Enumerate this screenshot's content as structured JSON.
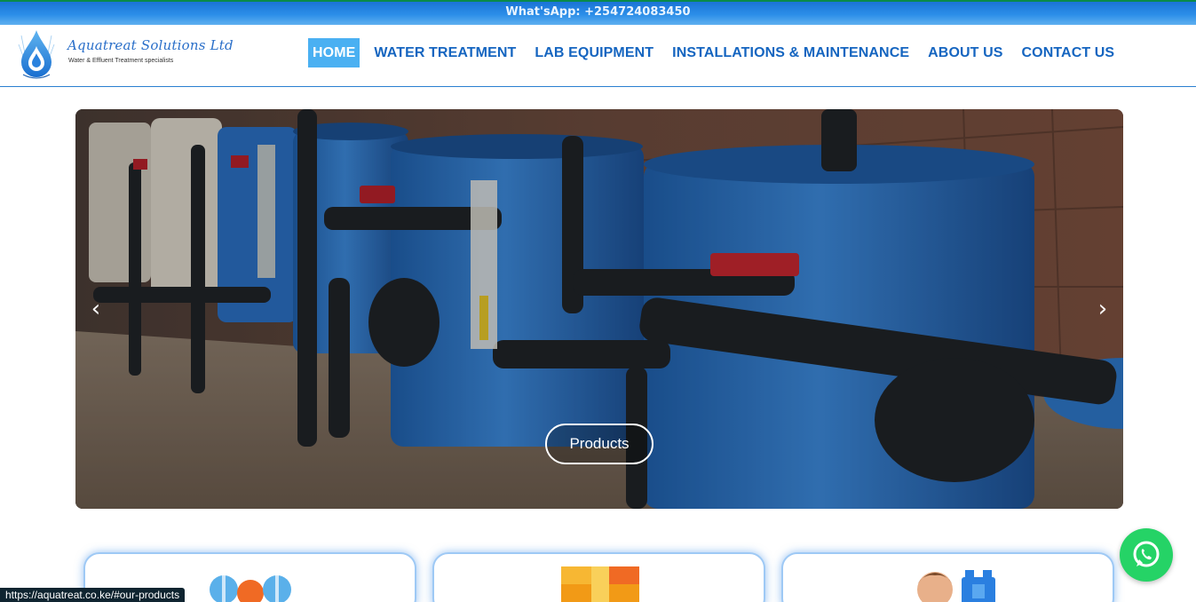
{
  "topbar": {
    "contact": "What'sApp: +254724083450"
  },
  "brand": {
    "name": "Aquatreat Solutions Ltd",
    "tagline": "Water & Effluent Treatment specialists"
  },
  "nav": {
    "items": [
      {
        "label": "HOME",
        "active": true
      },
      {
        "label": "WATER TREATMENT"
      },
      {
        "label": "LAB EQUIPMENT"
      },
      {
        "label": "INSTALLATIONS & MAINTENANCE"
      },
      {
        "label": "ABOUT US"
      },
      {
        "label": "CONTACT US"
      }
    ]
  },
  "hero": {
    "button_label": "Products",
    "prev_icon": "‹",
    "next_icon": "›"
  },
  "product_cards": [
    {
      "icon": "colored-dots-icon"
    },
    {
      "icon": "boxes-icon"
    },
    {
      "icon": "technician-icon"
    }
  ],
  "floating": {
    "whatsapp_icon": "whatsapp-icon"
  },
  "status_bar": {
    "url": "https://aquatreat.co.ke/#our-products"
  },
  "colors": {
    "brand_blue": "#1565c0",
    "active_nav": "#4ab0f2",
    "whatsapp_green": "#25d366"
  }
}
